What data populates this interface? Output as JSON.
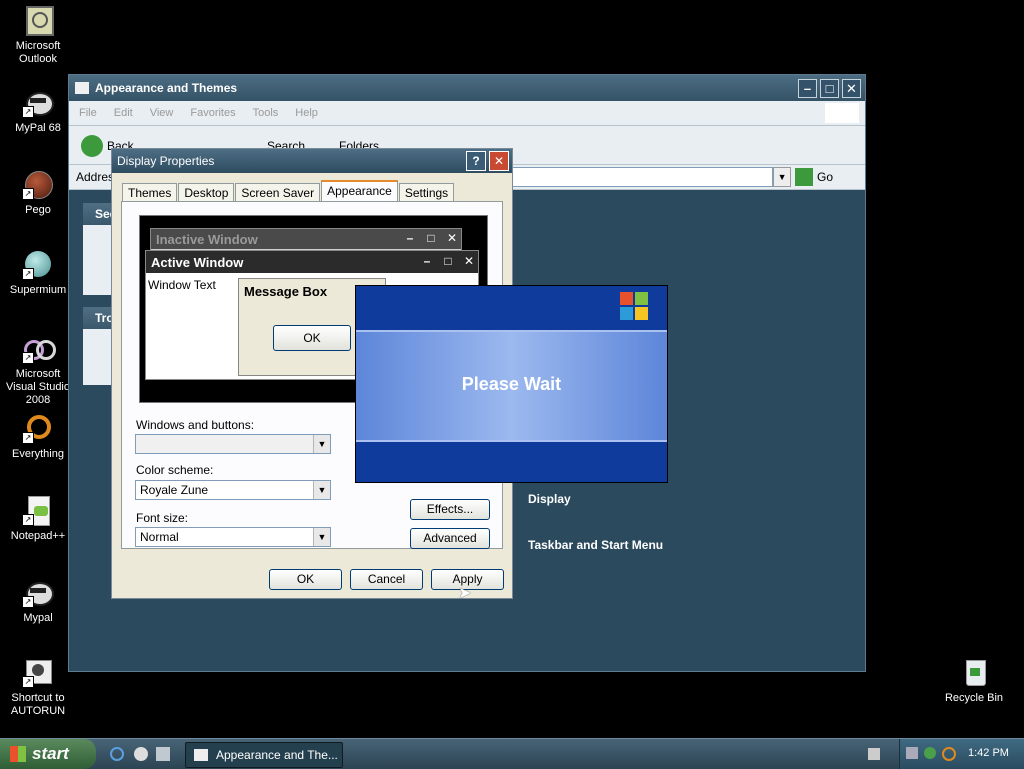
{
  "desktop": {
    "icons": [
      {
        "label": "Microsoft Outlook"
      },
      {
        "label": "MyPal 68"
      },
      {
        "label": "Pego"
      },
      {
        "label": "Supermium"
      },
      {
        "label": "Microsoft Visual Studio 2008"
      },
      {
        "label": "Everything"
      },
      {
        "label": "Notepad++"
      },
      {
        "label": "Mypal"
      },
      {
        "label": "Shortcut to AUTORUN"
      }
    ],
    "recycle_bin": "Recycle Bin"
  },
  "explorer": {
    "title": "Appearance and Themes",
    "menu": [
      "File",
      "Edit",
      "View",
      "Favorites",
      "Tools",
      "Help"
    ],
    "toolbar": {
      "back": "Back",
      "search": "Search",
      "folders": "Folders"
    },
    "address_label": "Address",
    "go_label": "Go",
    "left_panels": [
      {
        "heading": "See"
      },
      {
        "heading": "Tro"
      }
    ],
    "categories": [
      {
        "label": "Display"
      },
      {
        "label": "Taskbar and Start Menu"
      }
    ]
  },
  "display_properties": {
    "title": "Display Properties",
    "tabs": [
      "Themes",
      "Desktop",
      "Screen Saver",
      "Appearance",
      "Settings"
    ],
    "active_tab": "Appearance",
    "preview": {
      "inactive_title": "Inactive Window",
      "active_title": "Active Window",
      "window_text": "Window Text",
      "message_box_title": "Message Box",
      "ok_label": "OK"
    },
    "windows_buttons_label": "Windows and buttons:",
    "windows_buttons_value": "",
    "color_scheme_label": "Color scheme:",
    "color_scheme_value": "Royale Zune",
    "font_size_label": "Font size:",
    "font_size_value": "Normal",
    "effects_label": "Effects...",
    "advanced_label": "Advanced",
    "ok_label": "OK",
    "cancel_label": "Cancel",
    "apply_label": "Apply"
  },
  "please_wait": {
    "message": "Please Wait"
  },
  "taskbar": {
    "start_label": "start",
    "task_label": "Appearance and The...",
    "clock": "1:42 PM"
  },
  "colors": {
    "desktop_bg": "#000000",
    "window_frame": "#2b4a5e",
    "please_wait_blue": "#0f3b9c",
    "dialog_bg": "#ece9d8"
  }
}
